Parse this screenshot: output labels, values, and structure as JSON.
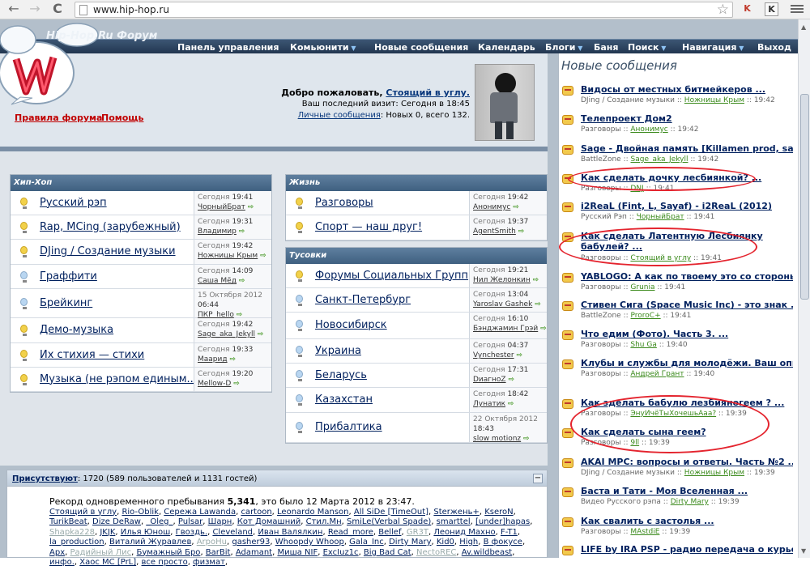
{
  "browser": {
    "url": "www.hip-hop.ru",
    "back": "←",
    "forward": "→",
    "reload": "C"
  },
  "site": {
    "logo_text": "Hip-Hop.Ru Форум"
  },
  "nav": [
    {
      "label": "Панель управления",
      "dd": false
    },
    {
      "label": "Комьюнити",
      "dd": true
    },
    {
      "label": "Новые сообщения",
      "dd": false
    },
    {
      "label": "Календарь",
      "dd": false
    },
    {
      "label": "Блоги",
      "dd": true
    },
    {
      "label": "Баня",
      "dd": false
    },
    {
      "label": "Поиск",
      "dd": true
    },
    {
      "label": "Навигация",
      "dd": true
    },
    {
      "label": "Выход",
      "dd": false
    }
  ],
  "header": {
    "rules": "Правила форума",
    "help": "Помощь",
    "welcome": "Добро пожаловать,",
    "username": "Стоящий в углу.",
    "last_visit": "Ваш последний визит: Сегодня в 18:45",
    "pm_link": "Личные сообщения",
    "pm_stats": ": Новых 0, всего 132."
  },
  "categories": {
    "hiphop": {
      "title": "Хип-Хоп",
      "forums": [
        {
          "name": "Русский рэп",
          "date": "Сегодня",
          "time": "19:41",
          "user": "ЧорныйБрат",
          "on": true
        },
        {
          "name": "Rap, MCing (зарубежный)",
          "date": "Сегодня",
          "time": "19:31",
          "user": "Владимир",
          "on": true
        },
        {
          "name": "DJing / Создание музыки",
          "date": "Сегодня",
          "time": "19:42",
          "user": "Ножницы Крым",
          "on": true
        },
        {
          "name": "Граффити",
          "date": "Сегодня",
          "time": "14:09",
          "user": "Саша Mёд",
          "on": false
        },
        {
          "name": "Брейкинг",
          "date": "15 Октября 2012",
          "time": "06:44",
          "user": "ПКР_hello",
          "on": false
        },
        {
          "name": "Демо-музыка",
          "date": "Сегодня",
          "time": "19:42",
          "user": "Sage_aka_Jekyll",
          "on": true
        },
        {
          "name": "Их стихия — стихи",
          "date": "Сегодня",
          "time": "19:33",
          "user": "Маарид",
          "on": true
        },
        {
          "name": "Музыка (не рэпом единым...)",
          "date": "Сегодня",
          "time": "19:20",
          "user": "Mellow-D",
          "on": true
        }
      ]
    },
    "life": {
      "title": "Жизнь",
      "forums": [
        {
          "name": "Разговоры",
          "date": "Сегодня",
          "time": "19:42",
          "user": "Анонимус",
          "on": true
        },
        {
          "name": "Спорт — наш друг!",
          "date": "Сегодня",
          "time": "19:37",
          "user": "AgentSmith",
          "on": true
        }
      ]
    },
    "hangout": {
      "title": "Тусовки",
      "forums": [
        {
          "name": "Форумы Социальных Групп",
          "date": "Сегодня",
          "time": "19:21",
          "user": "Нил Желонкин",
          "on": true
        },
        {
          "name": "Санкт-Петербург",
          "date": "Сегодня",
          "time": "13:04",
          "user": "Yaroslav Gashek",
          "on": false
        },
        {
          "name": "Новосибирск",
          "date": "Сегодня",
          "time": "16:10",
          "user": "Бэнджамин Грэй",
          "on": false
        },
        {
          "name": "Украина",
          "date": "Сегодня",
          "time": "04:37",
          "user": "Vynchester",
          "on": false
        },
        {
          "name": "Беларусь",
          "date": "Сегодня",
          "time": "17:31",
          "user": "DиагноZ",
          "on": false
        },
        {
          "name": "Казахстан",
          "date": "Сегодня",
          "time": "18:42",
          "user": "Лунатик",
          "on": false
        },
        {
          "name": "Прибалтика",
          "date": "22 Октября 2012",
          "time": "18:43",
          "user": "slow motionz",
          "on": false
        }
      ]
    }
  },
  "online": {
    "label": "Присутствуют",
    "stats": ": 1720 (589 пользователей и 1131 гостей)",
    "record_a": "Рекорд одновременного пребывания ",
    "record_n": "5,341",
    "record_b": ", это было 12 Марта 2012 в 23:47.",
    "users": [
      "Стоящий в углу",
      "Rio-Oblik",
      "Сережа Lawanda",
      "cartoon",
      "Leonardo Manson",
      "All SiDe [TimeOut]",
      "Sterжень+",
      "KseroN",
      "TurikBeat",
      "Dize DeRaw",
      "_Oleg_",
      "Pulsar",
      "Шарн",
      "Кот Домашний",
      "Стил.Мн",
      "SmiLe(Verbal Spade)",
      "smarttel",
      "[under]hapas",
      "Shapka228",
      "JKJK",
      "Илья Юнош",
      "Гвоздь.",
      "Cleveland",
      "Иван Валялкин",
      "Read_more",
      "Bellef",
      "GR3T",
      "Леонид Махно",
      "F-T1",
      "la_production",
      "Виталий Журавлев",
      "ArpoHu",
      "gasher93",
      "Whoopdy Whoop",
      "Gala_Inc",
      "Dirty Mary",
      "Kid0",
      "High",
      "В фокусе",
      "Apx",
      "Радийный Лис",
      "Бумажный Бро",
      "BarBit",
      "Adamant",
      "Миша NIF",
      "ExcIuz1c",
      "Big Bad Cat",
      "NectoREC",
      "Av.wildbeast",
      "инфо.",
      "Хаос МС [PrL]",
      "все просто",
      "физмат"
    ]
  },
  "new_posts": {
    "title": "Новые сообщения",
    "items": [
      {
        "title": "Видосы от местных битмейкеров ...",
        "forum": "DJing / Создание музыки",
        "user": "Ножницы Крым",
        "time": "19:42"
      },
      {
        "title": "Телепроект Дом2",
        "forum": "Разговоры",
        "user": "Анонимус",
        "time": "19:42"
      },
      {
        "title": "Sage - Двойная память [Killamen prod, sa ...",
        "forum": "BattleZone",
        "user": "Sage_aka_Jekyll",
        "time": "19:42"
      },
      {
        "title": "Как сделать дочку лесбиянкой? ...",
        "forum": "Разговоры",
        "user": "DNJ",
        "time": "19:41"
      },
      {
        "title": "i2ReaL (Fint, L, Sayaf) - i2ReaL (2012)",
        "forum": "Русский Рэп",
        "user": "ЧорныйБрат",
        "time": "19:41"
      },
      {
        "title": "Как сделать Латентную Лесбиянку бабулей? ...",
        "forum": "Разговоры",
        "user": "Стоящий в углу",
        "time": "19:41"
      },
      {
        "title": "YABLOGO: А как по твоему это со стороны ...",
        "forum": "Разговоры",
        "user": "Grunia",
        "time": "19:41"
      },
      {
        "title": "Стивен Сига (Space Music Inc) - это знак ...",
        "forum": "BattleZone",
        "user": "ProroC+",
        "time": "19:41"
      },
      {
        "title": "Что едим (Фото). Часть 3. ...",
        "forum": "Разговоры",
        "user": "Shu Ga",
        "time": "19:40"
      },
      {
        "title": "Клубы и службы для молодёжи. Ваш опыт ...",
        "forum": "Разговоры",
        "user": "Андрей Грант",
        "time": "19:40"
      },
      {
        "title": "Как зделать бабулю лезбияногеем ? ...",
        "forum": "Разговоры",
        "user": "ЭнуИчёТыХочешьAaa?",
        "time": "19:39"
      },
      {
        "title": "Как сделать сына геем?",
        "forum": "Разговоры",
        "user": "9ll",
        "time": "19:39"
      },
      {
        "title": "AKAI MPC: вопросы и ответы. Часть №2 ...",
        "forum": "DJing / Создание музыки",
        "user": "Ножницы Крым",
        "time": "19:39"
      },
      {
        "title": "Баста и Тати - Моя Вселенная ...",
        "forum": "Видео Русского рэпа",
        "user": "Dirty Mary",
        "time": "19:39"
      },
      {
        "title": "Как свалить с застолья ...",
        "forum": "Разговоры",
        "user": "MAstdiE",
        "time": "19:39"
      },
      {
        "title": "LIFE by IRA PSP - радио передача о курье ...",
        "forum": "",
        "user": "",
        "time": ""
      }
    ]
  },
  "colors": {
    "accent_link": "#00205e",
    "header_red": "#c00000",
    "circle": "#e4242e"
  }
}
